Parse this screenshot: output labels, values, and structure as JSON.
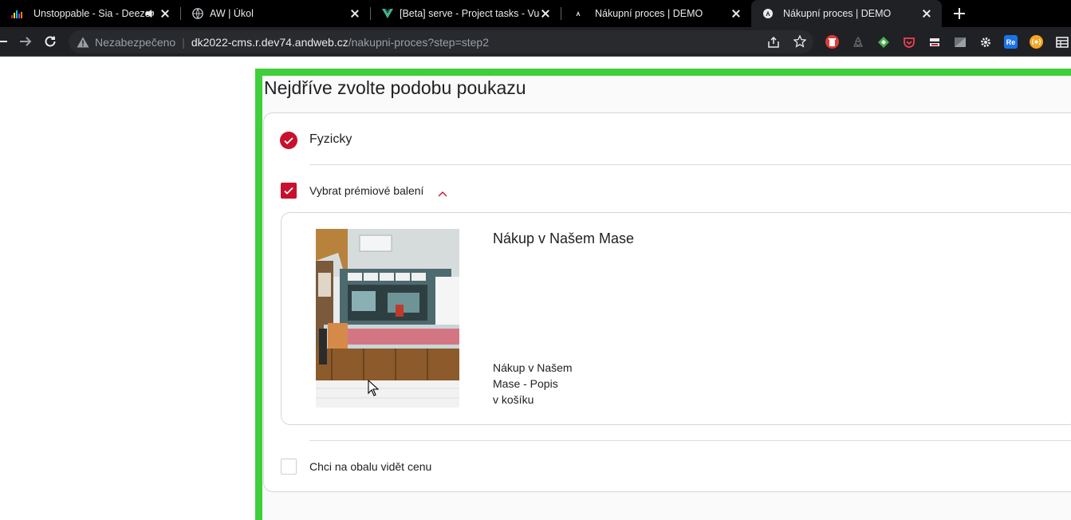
{
  "browser": {
    "tabs": [
      {
        "title": "Unstoppable - Sia - Deezer",
        "audio": true,
        "active": false
      },
      {
        "title": "AW | Úkol",
        "active": false
      },
      {
        "title": "[Beta] serve - Project tasks - Vue",
        "active": false
      },
      {
        "title": "Nákupní proces | DEMO",
        "active": false
      },
      {
        "title": "Nákupní proces | DEMO",
        "active": true
      }
    ],
    "address": {
      "security_label": "Nezabezpečeno",
      "host": "dk2022-cms.r.dev74.andweb.cz",
      "path": "/nakupni-proces?step=step2"
    }
  },
  "page": {
    "heading": "Nejdříve zvolte podobu poukazu",
    "option_physical": {
      "label": "Fyzicky",
      "selected": true
    },
    "premium_packaging": {
      "label": "Vybrat prémiové balení",
      "checked": true,
      "expanded": true
    },
    "product": {
      "name": "Nákup v Našem Mase",
      "description_lines": [
        "Nákup v Našem",
        "Mase - Popis",
        "v košíku"
      ]
    },
    "show_price": {
      "label": "Chci na obalu vidět cenu",
      "checked": false
    }
  },
  "colors": {
    "accent": "#c8102e",
    "frame": "#3ecf3a"
  }
}
